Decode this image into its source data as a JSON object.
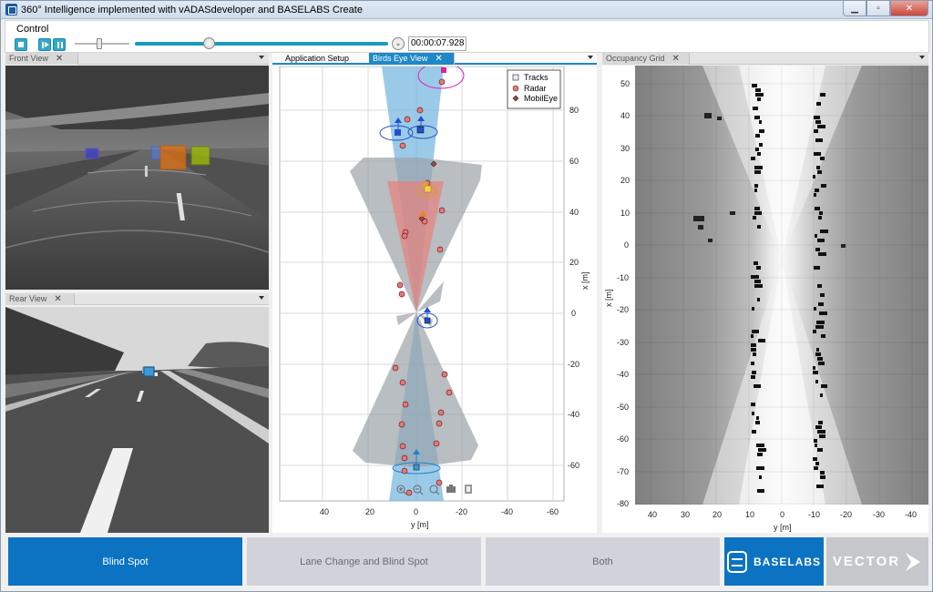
{
  "window": {
    "title": "360° Intelligence implemented with vADASdeveloper and BASELABS Create",
    "buttons": [
      "minimize",
      "maximize",
      "close"
    ]
  },
  "control": {
    "label": "Control",
    "time_value": "00:00:07.928",
    "progress_fraction": 0.29
  },
  "panels": {
    "front": {
      "tab": "Front View"
    },
    "rear": {
      "tab": "Rear View"
    },
    "center_tabs": [
      "Application Setup",
      "Birds Eye View"
    ],
    "occupancy": {
      "tab": "Occupancy Grid"
    }
  },
  "birdseye": {
    "legend": [
      "Tracks",
      "Radar",
      "MobilEye"
    ],
    "xlabel": "y [m]",
    "ylabel": "x [m]",
    "xticks": [
      "40",
      "20",
      "0",
      "-20",
      "-40",
      "-60"
    ],
    "yticks": [
      "80",
      "60",
      "40",
      "20",
      "0",
      "-20",
      "-40",
      "-60"
    ]
  },
  "occupancy_grid": {
    "xlabel": "y [m]",
    "ylabel": "x [m]",
    "xticks": [
      "40",
      "30",
      "20",
      "10",
      "0",
      "-10",
      "-20",
      "-30",
      "-40"
    ],
    "yticks": [
      "50",
      "40",
      "30",
      "20",
      "10",
      "0",
      "-10",
      "-20",
      "-30",
      "-40",
      "-50",
      "-60",
      "-70",
      "-80"
    ]
  },
  "modes": {
    "blind_spot": "Blind Spot",
    "lane_change": "Lane Change and Blind Spot",
    "both": "Both"
  },
  "logos": {
    "baselabs": "BASELABS",
    "vector": "VECTOR"
  },
  "colors": {
    "accent": "#0c73c3",
    "track": "#1e5ec8",
    "radar": "#e07a7a",
    "mobileye": "#9a4a4a"
  }
}
